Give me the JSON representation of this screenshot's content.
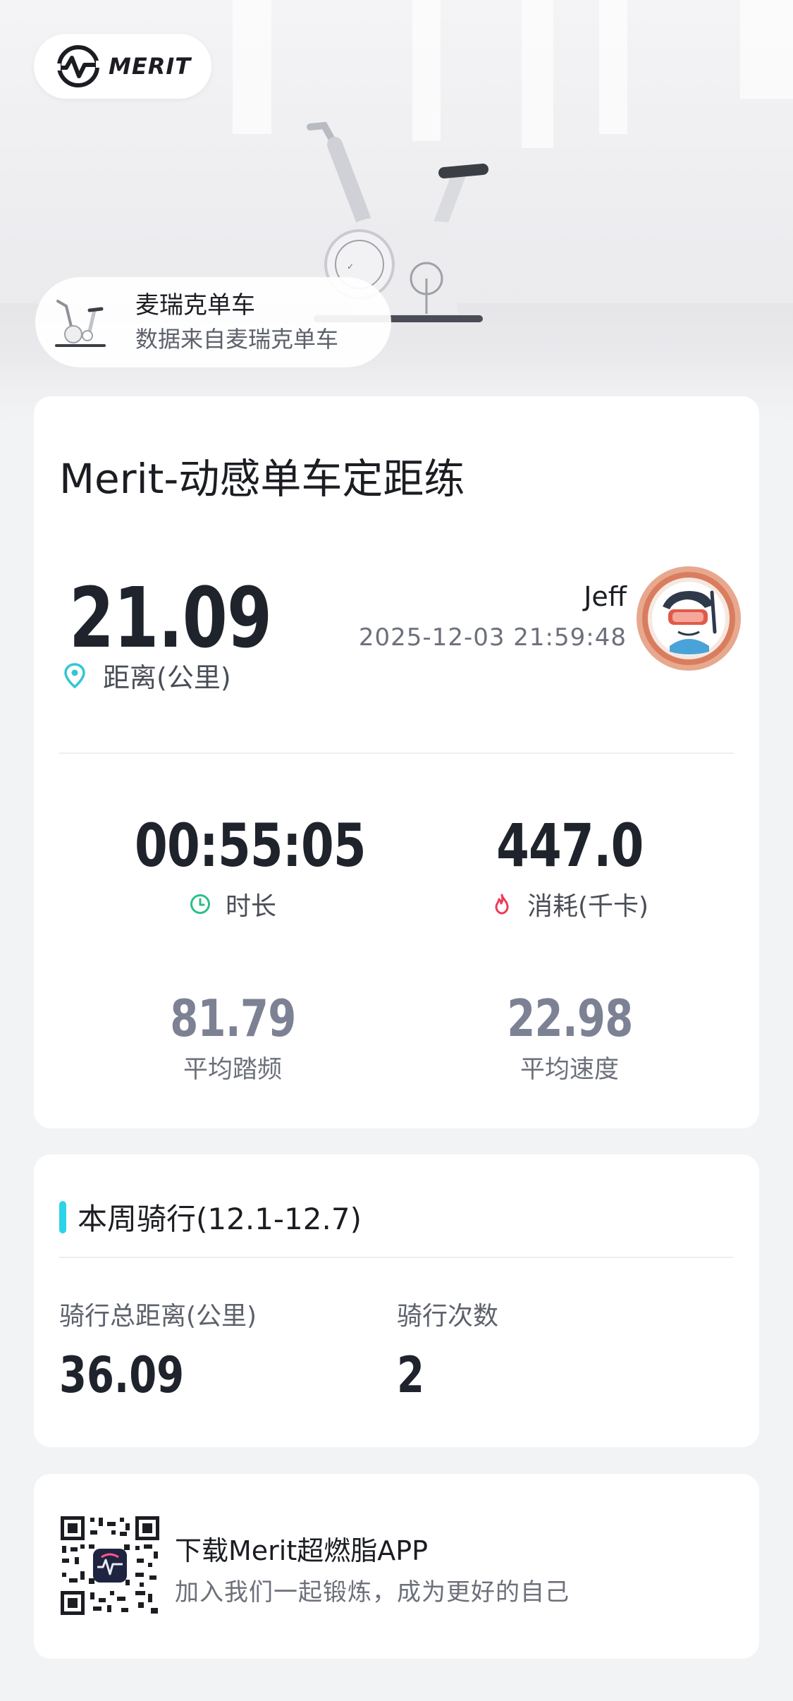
{
  "brand": {
    "logo_text": "MERIT"
  },
  "device": {
    "name": "麦瑞克单车",
    "source": "数据来自麦瑞克单车"
  },
  "workout": {
    "title": "Merit-动感单车定距练",
    "distance": {
      "value": "21.09",
      "label": "距离(公里)"
    },
    "user": {
      "name": "Jeff",
      "datetime": "2025-12-03 21:59:48"
    },
    "duration": {
      "value": "00:55:05",
      "label": "时长"
    },
    "calories": {
      "value": "447.0",
      "label": "消耗(千卡)"
    },
    "avg_cadence": {
      "value": "81.79",
      "label": "平均踏频"
    },
    "avg_speed": {
      "value": "22.98",
      "label": "平均速度"
    }
  },
  "weekly": {
    "title": "本周骑行(12.1-12.7)",
    "total_distance": {
      "label": "骑行总距离(公里)",
      "value": "36.09"
    },
    "ride_count": {
      "label": "骑行次数",
      "value": "2"
    }
  },
  "app_promo": {
    "title": "下载Merit超燃脂APP",
    "subtitle": "加入我们一起锻炼，成为更好的自己"
  },
  "colors": {
    "accent_cyan": "#2dd3e8",
    "location_icon": "#33c6d6",
    "clock_icon": "#2bbf8a",
    "flame_icon": "#ee3a57",
    "secondary_numbers": "#7d8194"
  },
  "icons": [
    "merit-logo-icon",
    "location-pin-icon",
    "clock-icon",
    "flame-icon",
    "qr-code-icon",
    "avatar-badge-icon",
    "bike-image"
  ]
}
